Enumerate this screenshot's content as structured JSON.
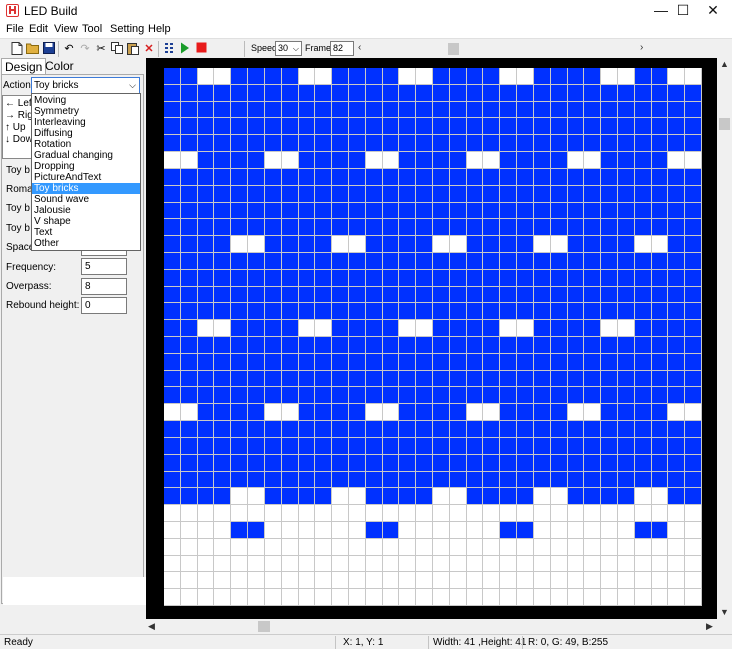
{
  "window": {
    "title": "LED Build",
    "minimize": "—",
    "maximize": "☐",
    "close": "✕"
  },
  "menu": [
    "File",
    "Edit",
    "View",
    "Tool",
    "Setting",
    "Help"
  ],
  "toolbar": {
    "speed_label": "Speed:",
    "speed_value": "30",
    "frame_label": "Frame:",
    "frame_value": "82",
    "colors": {
      "play": "#1a9c2a",
      "stop": "#e81b1b",
      "delete": "#d61f1f",
      "open": "#e0b040"
    }
  },
  "tabs": {
    "design": "Design",
    "color": "Color"
  },
  "action": {
    "label": "Action:",
    "selected": "Toy bricks",
    "options": [
      "Moving",
      "Symmetry",
      "Interleaving",
      "Diffusing",
      "Rotation",
      "Gradual changing",
      "Dropping",
      "PictureAndText",
      "Toy bricks",
      "Sound wave",
      "Jalousie",
      "V shape",
      "Text",
      "Other"
    ],
    "selected_index": 8
  },
  "directions": [
    {
      "arrow": "←",
      "label": "Left"
    },
    {
      "arrow": "→",
      "label": "Right"
    },
    {
      "arrow": "↑",
      "label": "Up"
    },
    {
      "arrow": "↓",
      "label": "Down"
    }
  ],
  "params": [
    {
      "label": "Toy b",
      "value": ""
    },
    {
      "label": "Roma",
      "value": ""
    },
    {
      "label": "Toy b",
      "value": ""
    },
    {
      "label": "Toy b",
      "value": ""
    },
    {
      "label": "Space",
      "value": ""
    },
    {
      "label": "Frequency:",
      "value": "5"
    },
    {
      "label": "Overpass:",
      "value": "8"
    },
    {
      "label": "Rebound height:",
      "value": "0"
    }
  ],
  "status": {
    "ready": "Ready",
    "coords": "X: 1, Y: 1",
    "size": "Width: 41 ,Height: 41",
    "color": "R:  0, G: 49, B:255"
  },
  "led_color": "#0031ff",
  "led_matrix": {
    "cols": 32,
    "rows": 32,
    "pattern_rows": [
      "11001111001111001111001111001100",
      "11111111111111111111111111111111",
      "11111111111111111111111111111111",
      "11111111111111111111111111111111",
      "11111111111111111111111111111111",
      "00111100111100111100111100111100",
      "11111111111111111111111111111111",
      "11111111111111111111111111111111",
      "11111111111111111111111111111111",
      "11111111111111111111111111111111",
      "11110011110011110011110011110011",
      "11111111111111111111111111111111",
      "11111111111111111111111111111111",
      "11111111111111111111111111111111",
      "11111111111111111111111111111111",
      "11001111001111001111001111001111",
      "11111111111111111111111111111111",
      "11111111111111111111111111111111",
      "11111111111111111111111111111111",
      "11111111111111111111111111111111",
      "00111100111100111100111100111100",
      "11111111111111111111111111111111",
      "11111111111111111111111111111111",
      "11111111111111111111111111111111",
      "11111111111111111111111111111111",
      "11110011110011110011110011110011",
      "00000000000000000000000000000000",
      "00001100000011000000110000001100",
      "00000000000000000000000000000000",
      "00000000000000000000000000000000",
      "00000000000000000000000000000000",
      "00000000000000000000000000000000"
    ]
  }
}
